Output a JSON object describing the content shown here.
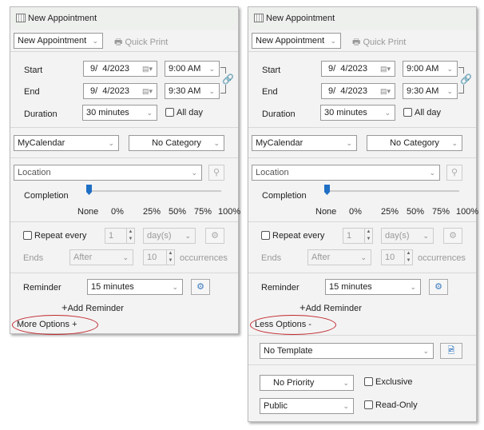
{
  "panels": [
    {
      "title": "New Appointment",
      "form_select": "New Appointment",
      "quick_print": "Quick Print",
      "start_label": "Start",
      "start_date": "9/  4/2023",
      "start_time": "9:00 AM",
      "end_label": "End",
      "end_date": "9/  4/2023",
      "end_time": "9:30 AM",
      "duration_label": "Duration",
      "duration": "30 minutes",
      "all_day": "All day",
      "calendar": "MyCalendar",
      "category": "No Category",
      "location_placeholder": "Location",
      "completion_label": "Completion",
      "completion_ticks": [
        "None",
        "0%",
        "25%",
        "50%",
        "75%",
        "100%"
      ],
      "completion_value": "None",
      "repeat_label": "Repeat every",
      "repeat_count": "1",
      "repeat_unit": "day(s)",
      "ends_label": "Ends",
      "ends_mode": "After",
      "ends_count": "10",
      "occurrences": "occurrences",
      "reminder_label": "Reminder",
      "reminder": "15 minutes",
      "add_reminder": "Add Reminder",
      "options_toggle": "More Options +"
    },
    {
      "title": "New Appointment",
      "form_select": "New Appointment",
      "quick_print": "Quick Print",
      "start_label": "Start",
      "start_date": "9/  4/2023",
      "start_time": "9:00 AM",
      "end_label": "End",
      "end_date": "9/  4/2023",
      "end_time": "9:30 AM",
      "duration_label": "Duration",
      "duration": "30 minutes",
      "all_day": "All day",
      "calendar": "MyCalendar",
      "category": "No Category",
      "location_placeholder": "Location",
      "completion_label": "Completion",
      "completion_ticks": [
        "None",
        "0%",
        "25%",
        "50%",
        "75%",
        "100%"
      ],
      "completion_value": "None",
      "repeat_label": "Repeat every",
      "repeat_count": "1",
      "repeat_unit": "day(s)",
      "ends_label": "Ends",
      "ends_mode": "After",
      "ends_count": "10",
      "occurrences": "occurrences",
      "reminder_label": "Reminder",
      "reminder": "15 minutes",
      "add_reminder": "Add Reminder",
      "options_toggle": "Less Options -",
      "template": "No Template",
      "priority": "No Priority",
      "exclusive": "Exclusive",
      "visibility": "Public",
      "read_only": "Read-Only"
    }
  ],
  "colors": {
    "accent": "#1f6fc5",
    "highlight_oval": "#c0272d",
    "panel_bg": "#f3f3f3"
  }
}
